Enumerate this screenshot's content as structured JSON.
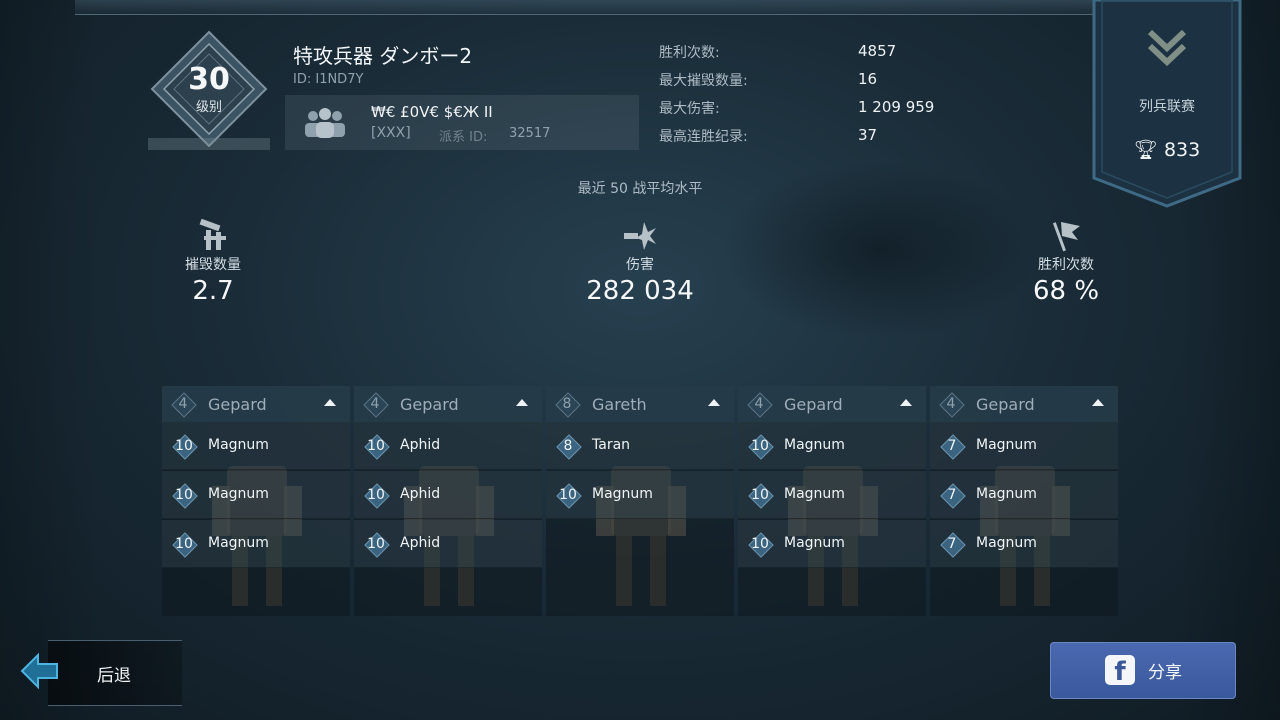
{
  "player": {
    "level": "30",
    "level_label": "级别",
    "name": "特攻兵器 ダンボー2",
    "id": "ID: I1ND7Y"
  },
  "clan": {
    "name": "₩€ £0V€ $€Ж II",
    "tag": "[XXX]",
    "id_label": "派系 ID:",
    "id": "32517"
  },
  "stats": [
    {
      "label": "胜利次数:",
      "value": "4857"
    },
    {
      "label": "最大摧毁数量:",
      "value": "16"
    },
    {
      "label": "最大伤害:",
      "value": "1 209 959"
    },
    {
      "label": "最高连胜纪录:",
      "value": "37"
    }
  ],
  "league": {
    "name": "列兵联赛",
    "trophies": "833",
    "icon": "chevron-rank-icon"
  },
  "averages": {
    "title": "最近 50 战平均水平",
    "kills": {
      "label": "摧毁数量",
      "value": "2.7"
    },
    "damage": {
      "label": "伤害",
      "value": "282 034"
    },
    "wins": {
      "label": "胜利次数",
      "value": "68 %"
    }
  },
  "loadouts": [
    {
      "level": "4",
      "robot": "Gepard",
      "weapons": [
        {
          "level": "10",
          "name": "Magnum"
        },
        {
          "level": "10",
          "name": "Magnum"
        },
        {
          "level": "10",
          "name": "Magnum"
        }
      ]
    },
    {
      "level": "4",
      "robot": "Gepard",
      "weapons": [
        {
          "level": "10",
          "name": "Aphid"
        },
        {
          "level": "10",
          "name": "Aphid"
        },
        {
          "level": "10",
          "name": "Aphid"
        }
      ]
    },
    {
      "level": "8",
      "robot": "Gareth",
      "weapons": [
        {
          "level": "8",
          "name": "Taran"
        },
        {
          "level": "10",
          "name": "Magnum"
        }
      ]
    },
    {
      "level": "4",
      "robot": "Gepard",
      "weapons": [
        {
          "level": "10",
          "name": "Magnum"
        },
        {
          "level": "10",
          "name": "Magnum"
        },
        {
          "level": "10",
          "name": "Magnum"
        }
      ]
    },
    {
      "level": "4",
      "robot": "Gepard",
      "weapons": [
        {
          "level": "7",
          "name": "Magnum"
        },
        {
          "level": "7",
          "name": "Magnum"
        },
        {
          "level": "7",
          "name": "Magnum"
        }
      ]
    }
  ],
  "buttons": {
    "back": "后退",
    "share": "分享"
  },
  "colors": {
    "accent": "#3b6481",
    "facebook": "#3b5998",
    "panel": "#2b4556"
  }
}
